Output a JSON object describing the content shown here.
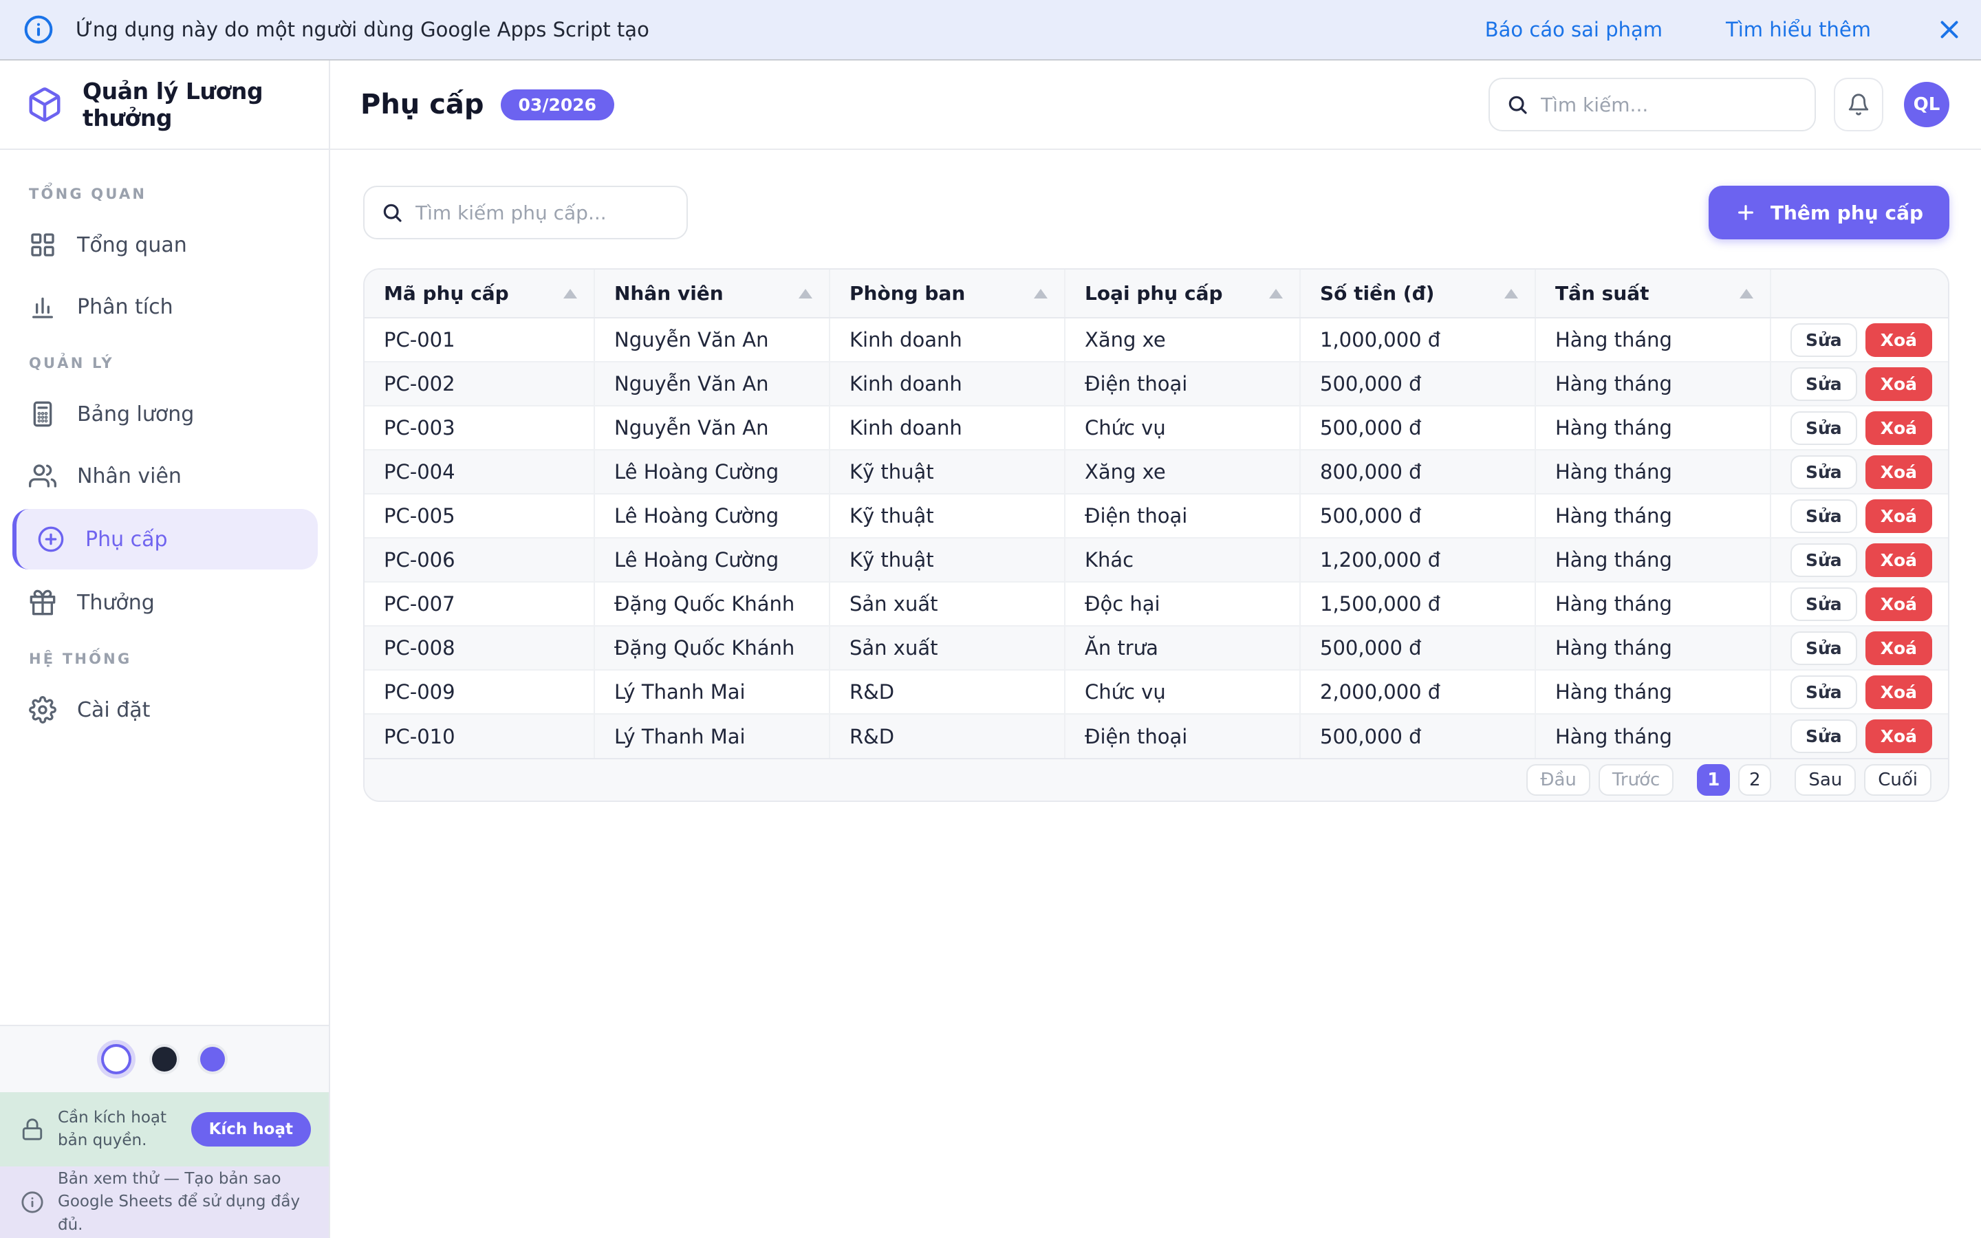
{
  "banner": {
    "message": "Ứng dụng này do một người dùng Google Apps Script tạo",
    "report_link": "Báo cáo sai phạm",
    "learn_more_link": "Tìm hiểu thêm"
  },
  "sidebar": {
    "app_title": "Quản lý Lương thưởng",
    "sections": [
      {
        "title": "TỔNG QUAN",
        "items": [
          {
            "label": "Tổng quan",
            "icon": "grid-icon",
            "active": false
          },
          {
            "label": "Phân tích",
            "icon": "bar-chart-icon",
            "active": false
          }
        ]
      },
      {
        "title": "QUẢN LÝ",
        "items": [
          {
            "label": "Bảng lương",
            "icon": "calculator-icon",
            "active": false
          },
          {
            "label": "Nhân viên",
            "icon": "users-icon",
            "active": false
          },
          {
            "label": "Phụ cấp",
            "icon": "plus-circle-icon",
            "active": true
          },
          {
            "label": "Thưởng",
            "icon": "gift-icon",
            "active": false
          }
        ]
      },
      {
        "title": "HỆ THỐNG",
        "items": [
          {
            "label": "Cài đặt",
            "icon": "gear-icon",
            "active": false
          }
        ]
      }
    ],
    "theme_dots": [
      {
        "name": "light",
        "color": "#ffffff",
        "selected": true
      },
      {
        "name": "dark",
        "color": "#1e2433",
        "selected": false
      },
      {
        "name": "purple",
        "color": "#6c63f0",
        "selected": false
      }
    ],
    "license_banner": {
      "text": "Cần kích hoạt bản quyền.",
      "button_label": "Kích hoạt"
    },
    "preview_banner": {
      "text": "Bản xem thử — Tạo bản sao Google Sheets để sử dụng đầy đủ."
    }
  },
  "header": {
    "page_title": "Phụ cấp",
    "period_badge": "03/2026",
    "search_placeholder": "Tìm kiếm...",
    "avatar_initials": "QL"
  },
  "toolbar": {
    "search_placeholder": "Tìm kiếm phụ cấp...",
    "add_button_label": "Thêm phụ cấp"
  },
  "table": {
    "columns": [
      "Mã phụ cấp",
      "Nhân viên",
      "Phòng ban",
      "Loại phụ cấp",
      "Số tiền (đ)",
      "Tần suất"
    ],
    "rows": [
      [
        "PC-001",
        "Nguyễn Văn An",
        "Kinh doanh",
        "Xăng xe",
        "1,000,000 đ",
        "Hàng tháng"
      ],
      [
        "PC-002",
        "Nguyễn Văn An",
        "Kinh doanh",
        "Điện thoại",
        "500,000 đ",
        "Hàng tháng"
      ],
      [
        "PC-003",
        "Nguyễn Văn An",
        "Kinh doanh",
        "Chức vụ",
        "500,000 đ",
        "Hàng tháng"
      ],
      [
        "PC-004",
        "Lê Hoàng Cường",
        "Kỹ thuật",
        "Xăng xe",
        "800,000 đ",
        "Hàng tháng"
      ],
      [
        "PC-005",
        "Lê Hoàng Cường",
        "Kỹ thuật",
        "Điện thoại",
        "500,000 đ",
        "Hàng tháng"
      ],
      [
        "PC-006",
        "Lê Hoàng Cường",
        "Kỹ thuật",
        "Khác",
        "1,200,000 đ",
        "Hàng tháng"
      ],
      [
        "PC-007",
        "Đặng Quốc Khánh",
        "Sản xuất",
        "Độc hại",
        "1,500,000 đ",
        "Hàng tháng"
      ],
      [
        "PC-008",
        "Đặng Quốc Khánh",
        "Sản xuất",
        "Ăn trưa",
        "500,000 đ",
        "Hàng tháng"
      ],
      [
        "PC-009",
        "Lý Thanh Mai",
        "R&D",
        "Chức vụ",
        "2,000,000 đ",
        "Hàng tháng"
      ],
      [
        "PC-010",
        "Lý Thanh Mai",
        "R&D",
        "Điện thoại",
        "500,000 đ",
        "Hàng tháng"
      ]
    ],
    "edit_label": "Sửa",
    "delete_label": "Xoá"
  },
  "pagination": {
    "first": "Đầu",
    "prev": "Trước",
    "pages": [
      "1",
      "2"
    ],
    "current_page": "1",
    "next": "Sau",
    "last": "Cuối"
  },
  "colors": {
    "accent": "#6c63f0",
    "accent_light_bg": "#edebfc",
    "danger": "#e8484d",
    "banner_bg": "#e8edfb",
    "banner_link": "#1a73e8",
    "license_bg": "#d8ebe1",
    "preview_bg": "#e7e3f6"
  }
}
